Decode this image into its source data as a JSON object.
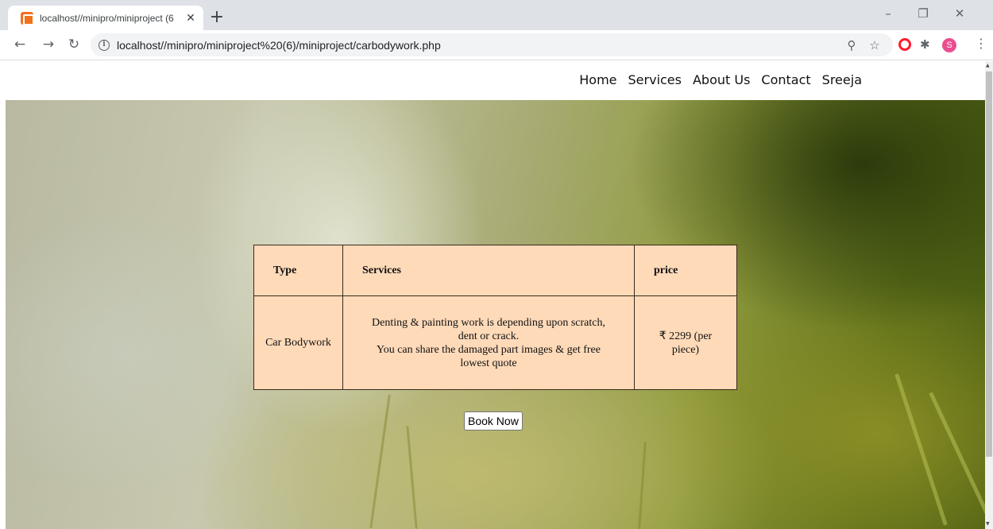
{
  "browser": {
    "tab_title": "localhost//minipro/miniproject (6",
    "tab_close": "✕",
    "new_tab": "+",
    "url": "localhost//minipro/miniproject%20(6)/miniproject/carbodywork.php",
    "profile_initial": "S",
    "icons": [
      "xampp-favicon",
      "back-icon",
      "forward-icon",
      "reload-icon",
      "info-icon",
      "zoom-icon",
      "star-icon",
      "opera-icon",
      "puzzle-icon",
      "menu-icon",
      "minimize-icon",
      "restore-icon",
      "close-icon"
    ]
  },
  "nav": {
    "links": [
      "Home",
      "Services",
      "About Us",
      "Contact",
      "Sreeja"
    ]
  },
  "table": {
    "headers": [
      "Type",
      "Services",
      "price"
    ],
    "row": {
      "type": "Car Bodywork",
      "services_line1": "Denting & painting work is depending upon scratch, dent or crack.",
      "services_line2": "You can share the damaged part images & get free lowest quote",
      "price": "₹ 2299 (per piece)"
    }
  },
  "book_button": "Book Now",
  "colors": {
    "table_bg": "#ffdab9",
    "tab_strip": "#dee1e6",
    "omnibox": "#f1f3f4"
  }
}
